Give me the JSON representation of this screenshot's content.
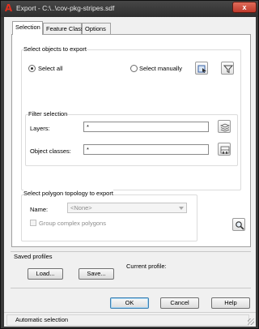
{
  "window": {
    "title": "Export - C:\\..\\cov-pkg-stripes.sdf",
    "app_icon": "autocad-icon",
    "close_label": "x"
  },
  "tabs": [
    {
      "label": "Selection",
      "active": true
    },
    {
      "label": "Feature Class",
      "active": false
    },
    {
      "label": "Options",
      "active": false
    }
  ],
  "select_objects": {
    "group_label": "Select objects to export",
    "select_all_label": "Select all",
    "select_manually_label": "Select manually",
    "selected": "select_all"
  },
  "filter": {
    "group_label": "Filter selection",
    "layers_label": "Layers:",
    "layers_value": "*",
    "object_classes_label": "Object classes:",
    "object_classes_value": "*"
  },
  "topology": {
    "group_label": "Select polygon topology to export",
    "name_label": "Name:",
    "name_value": "<None>",
    "group_complex_label": "Group complex polygons",
    "group_complex_checked": false
  },
  "profiles": {
    "group_label": "Saved profiles",
    "load_label": "Load...",
    "save_label": "Save...",
    "current_profile_label": "Current profile:"
  },
  "buttons": {
    "ok_label": "OK",
    "cancel_label": "Cancel",
    "help_label": "Help"
  },
  "status": {
    "text": "Automatic selection"
  }
}
